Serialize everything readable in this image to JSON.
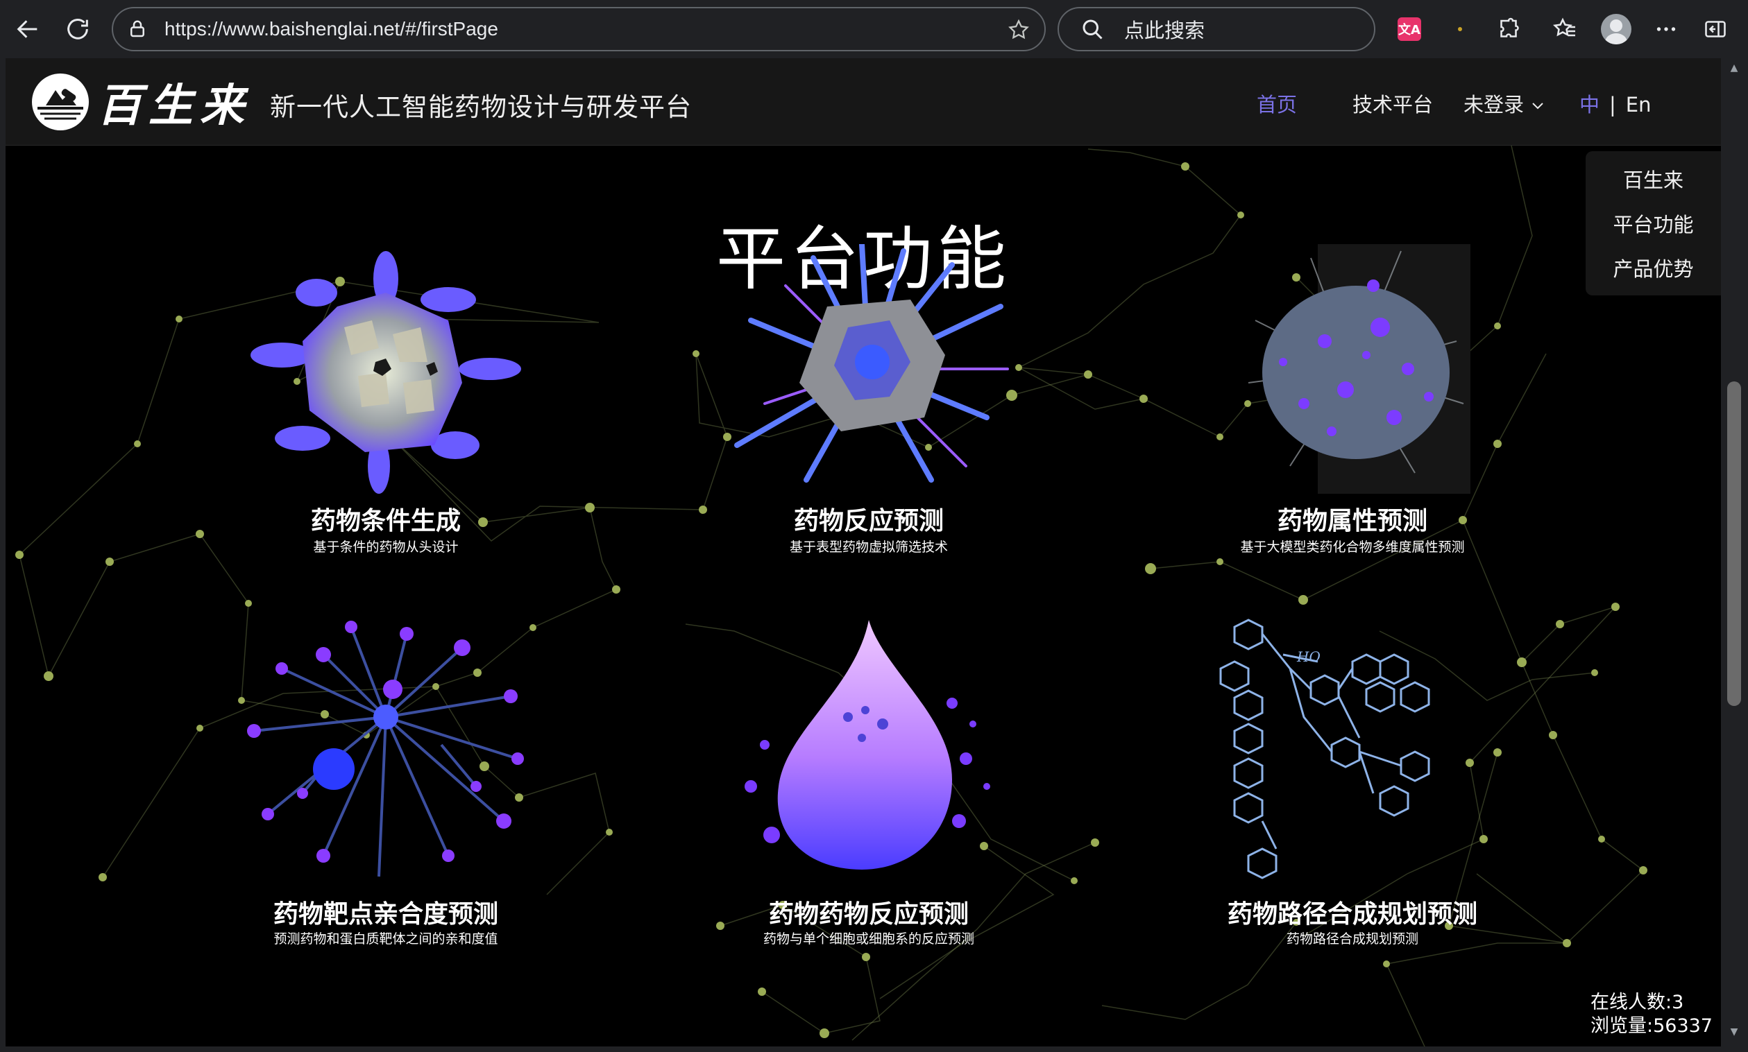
{
  "browser": {
    "url": "https://www.baishenglai.net/#/firstPage",
    "search_placeholder": "点此搜索",
    "translate_badge": "文A"
  },
  "site": {
    "logo_text": "百生来",
    "title": "新一代人工智能药物设计与研发平台",
    "nav": {
      "home": "首页",
      "tech": "技术平台",
      "login": "未登录",
      "lang_zh": "中",
      "lang_sep": "|",
      "lang_en": "En"
    }
  },
  "float_menu": [
    "百生来",
    "平台功能",
    "产品优势"
  ],
  "section_title": "平台功能",
  "cards": [
    {
      "title": "药物条件生成",
      "subtitle": "基于条件的药物从头设计"
    },
    {
      "title": "药物反应预测",
      "subtitle": "基于表型药物虚拟筛选技术"
    },
    {
      "title": "药物属性预测",
      "subtitle": "基于大模型类药化合物多维度属性预测"
    },
    {
      "title": "药物靶点亲合度预测",
      "subtitle": "预测药物和蛋白质靶体之间的亲和度值"
    },
    {
      "title": "药物药物反应预测",
      "subtitle": "药物与单个细胞或细胞系的反应预测"
    },
    {
      "title": "药物路径合成规划预测",
      "subtitle": "药物路径合成规划预测"
    }
  ],
  "stats": {
    "online": "在线人数:3",
    "views": "浏览量:56337"
  },
  "colors": {
    "accent": "#7b72e6",
    "network_node": "#9aab55",
    "molecule_purple": "#6a4cff",
    "molecule_blue": "#3b5bff"
  }
}
